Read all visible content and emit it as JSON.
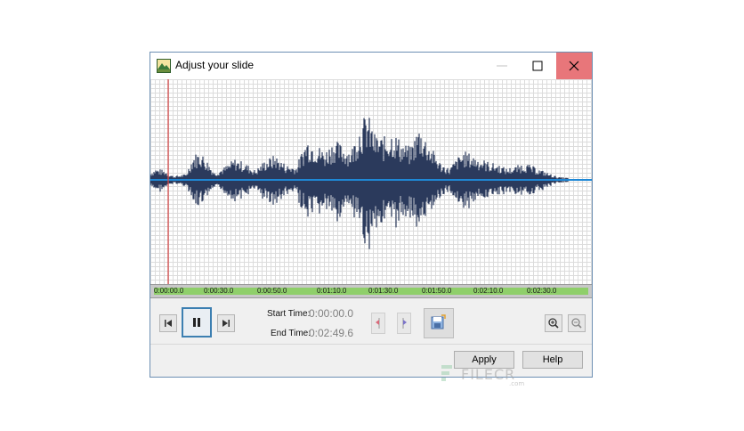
{
  "window": {
    "title": "Adjust your slide",
    "controls": [
      "minimize-icon",
      "maximize-icon",
      "close-icon"
    ],
    "close_hover_color": "#e8767a"
  },
  "waveform": {
    "wave_color": "#2b3a5c",
    "center_line_color": "#1e88d6",
    "playhead_color": "#d44a4a",
    "grid": true
  },
  "timeline": {
    "bar_color": "#8fcf6a",
    "ticks": [
      "0:00:00.0",
      "0:00:30.0",
      "0:00:50.0",
      "0:01:10.0",
      "0:01:30.0",
      "0:01:50.0",
      "0:02:10.0",
      "0:02:30.0"
    ]
  },
  "transport": {
    "buttons": [
      "skip-to-start-icon",
      "pause-icon",
      "skip-to-end-icon"
    ]
  },
  "times": {
    "start_label": "Start Time:",
    "start_value": "0:00:00.0",
    "end_label": "End Time:",
    "end_value": "0:02:49.6"
  },
  "actions": {
    "apply_label": "Apply",
    "help_label": "Help"
  },
  "watermark": {
    "text": "FILECR",
    "domain": ".com"
  }
}
